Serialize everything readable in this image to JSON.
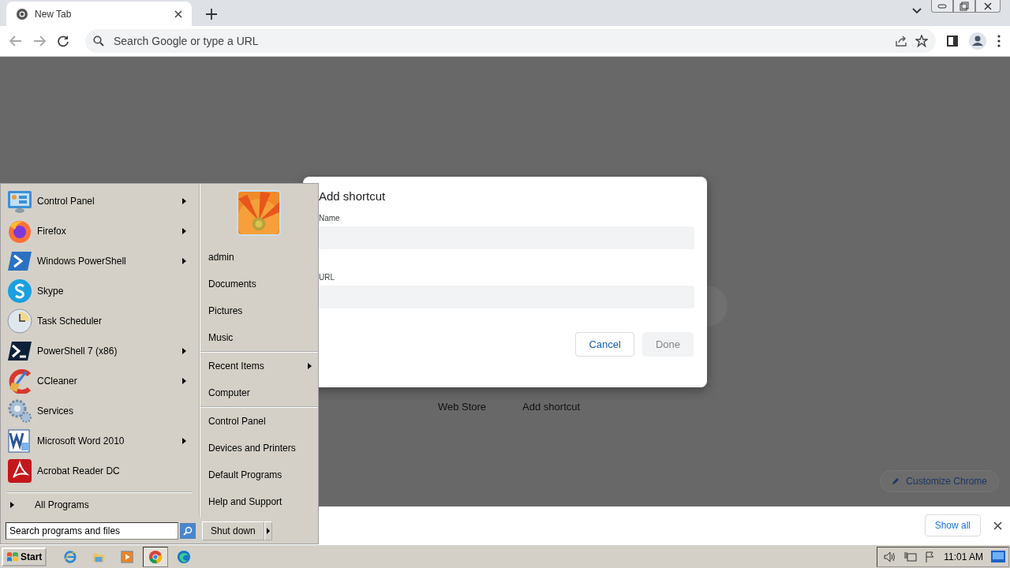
{
  "browser": {
    "tab": {
      "title": "New Tab",
      "selected": true
    },
    "omnibox": {
      "placeholder": "Search Google or type a URL"
    }
  },
  "new_tab_page": {
    "links": [
      "Web Store",
      "Add shortcut"
    ],
    "customize_button": "Customize Chrome"
  },
  "dialog": {
    "title": "Add shortcut",
    "fields": [
      {
        "label": "Name"
      },
      {
        "label": "URL"
      }
    ],
    "buttons": [
      {
        "label": "Cancel",
        "disabled": false
      },
      {
        "label": "Done",
        "disabled": true
      }
    ]
  },
  "downloads_bar": {
    "show_all": "Show all"
  },
  "start_menu": {
    "programs": [
      {
        "name": "Control Panel",
        "kind": "control-panel",
        "submenu": true
      },
      {
        "name": "Firefox",
        "kind": "firefox",
        "submenu": true
      },
      {
        "name": "Windows PowerShell",
        "kind": "powershell",
        "submenu": true
      },
      {
        "name": "Skype",
        "kind": "skype",
        "submenu": false
      },
      {
        "name": "Task Scheduler",
        "kind": "clock",
        "submenu": false
      },
      {
        "name": "PowerShell 7 (x86)",
        "kind": "terminal",
        "submenu": true
      },
      {
        "name": "CCleaner",
        "kind": "ccleaner",
        "submenu": true
      },
      {
        "name": "Services",
        "kind": "gears",
        "submenu": false
      },
      {
        "name": "Microsoft Word 2010",
        "kind": "word",
        "submenu": true
      },
      {
        "name": "Acrobat Reader DC",
        "kind": "acrobat",
        "submenu": false
      }
    ],
    "all_programs": "All Programs",
    "place_groups": [
      {
        "items": [
          {
            "label": "admin",
            "submenu": false
          },
          {
            "label": "Documents",
            "submenu": false
          },
          {
            "label": "Pictures",
            "submenu": false
          },
          {
            "label": "Music",
            "submenu": false
          }
        ]
      },
      {
        "items": [
          {
            "label": "Recent Items",
            "submenu": true
          },
          {
            "label": "Computer",
            "submenu": false
          }
        ]
      },
      {
        "items": [
          {
            "label": "Control Panel",
            "submenu": false
          },
          {
            "label": "Devices and Printers",
            "submenu": false
          },
          {
            "label": "Default Programs",
            "submenu": false
          },
          {
            "label": "Help and Support",
            "submenu": false
          }
        ]
      }
    ],
    "search": {
      "placeholder": "Search programs and files"
    },
    "shutdown": "Shut down"
  },
  "taskbar": {
    "start": "Start",
    "apps": [
      {
        "kind": "ie",
        "selected": false
      },
      {
        "kind": "explorer",
        "selected": false
      },
      {
        "kind": "media",
        "selected": false
      },
      {
        "kind": "chrome",
        "selected": true
      },
      {
        "kind": "edge",
        "selected": false
      }
    ],
    "clock": "11:01 AM"
  }
}
